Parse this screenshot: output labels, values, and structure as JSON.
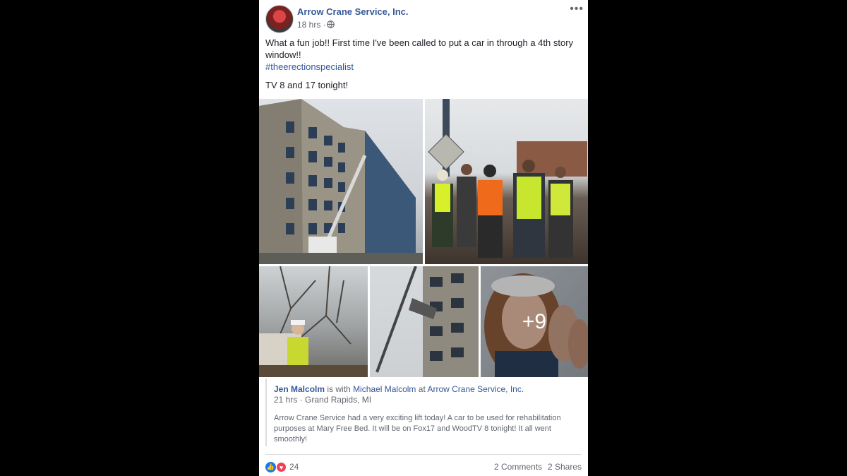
{
  "post": {
    "page_name": "Arrow Crane Service, Inc.",
    "time": "18 hrs",
    "time_separator": "·",
    "more_label": "•••",
    "privacy_icon": "globe-icon",
    "text_line1": "What a fun job!! First time I've been called to put a car in through a 4th story window!!",
    "hashtag": "#theerectionspecialist",
    "text_line2": "TV 8 and 17 tonight!"
  },
  "photos": {
    "items": [
      {
        "icon": "building-crane-photo"
      },
      {
        "icon": "workers-photo"
      },
      {
        "icon": "crane-operator-photo"
      },
      {
        "icon": "car-lift-photo"
      },
      {
        "icon": "selfie-photo"
      }
    ],
    "more_count": "+9"
  },
  "shared": {
    "author": "Jen Malcolm",
    "is_with": "is with",
    "with": "Michael Malcolm",
    "at": "at",
    "place": "Arrow Crane Service, Inc.",
    "time": "21 hrs",
    "separator": "·",
    "location": "Grand Rapids, MI",
    "text": "Arrow Crane Service had a very exciting lift today! A car to be used for rehabilitation purposes at Mary Free Bed. It will be on Fox17 and WoodTV 8 tonight! It all went smoothly!"
  },
  "footer": {
    "reaction_count": "24",
    "comments": "2 Comments",
    "shares": "2 Shares"
  },
  "colors": {
    "background": "#000000",
    "link": "#365899",
    "like_blue": "#1877f2",
    "love_red": "#f33e58"
  }
}
